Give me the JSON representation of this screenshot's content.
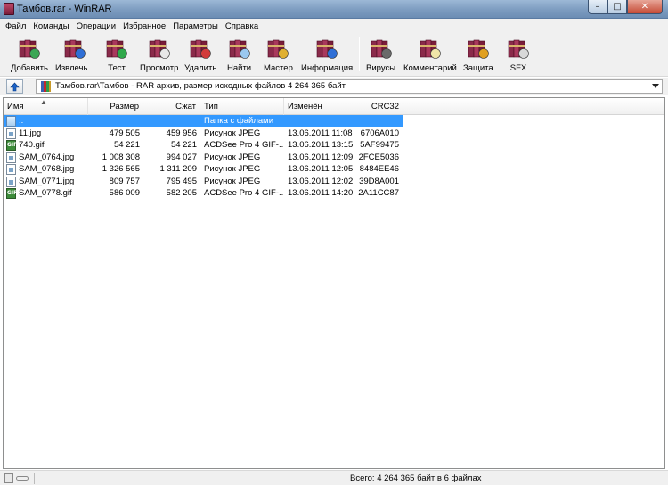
{
  "window": {
    "title": "Тамбов.rar - WinRAR",
    "min": "–",
    "max": "□",
    "close": "✕"
  },
  "menu": [
    "Файл",
    "Команды",
    "Операции",
    "Избранное",
    "Параметры",
    "Справка"
  ],
  "toolbar": {
    "buttons": [
      {
        "label": "Добавить",
        "icon": "books-add-icon"
      },
      {
        "label": "Извлечь...",
        "icon": "books-extract-icon"
      },
      {
        "label": "Тест",
        "icon": "books-test-icon"
      },
      {
        "label": "Просмотр",
        "icon": "books-view-icon"
      },
      {
        "label": "Удалить",
        "icon": "books-delete-icon"
      },
      {
        "label": "Найти",
        "icon": "books-find-icon"
      },
      {
        "label": "Мастер",
        "icon": "books-wizard-icon"
      },
      {
        "label": "Информация",
        "icon": "books-info-icon"
      },
      {
        "label": "Вирусы",
        "icon": "books-virus-icon"
      },
      {
        "label": "Комментарий",
        "icon": "books-comment-icon"
      },
      {
        "label": "Защита",
        "icon": "books-protect-icon"
      },
      {
        "label": "SFX",
        "icon": "books-sfx-icon"
      }
    ]
  },
  "address": {
    "text": "Тамбов.rar\\Тамбов - RAR архив, размер исходных файлов 4 264 365 байт"
  },
  "columns": {
    "name": "Имя",
    "size": "Размер",
    "packed": "Сжат",
    "type": "Тип",
    "modified": "Изменён",
    "crc": "CRC32"
  },
  "files": [
    {
      "name": "..",
      "size": "",
      "packed": "",
      "type": "Папка с файлами",
      "modified": "",
      "crc": "",
      "icon": "folder-up",
      "selected": true
    },
    {
      "name": "11.jpg",
      "size": "479 505",
      "packed": "459 956",
      "type": "Рисунок JPEG",
      "modified": "13.06.2011 11:08",
      "crc": "6706A010",
      "icon": "jpg"
    },
    {
      "name": "740.gif",
      "size": "54 221",
      "packed": "54 221",
      "type": "ACDSee Pro 4 GIF-...",
      "modified": "13.06.2011 13:15",
      "crc": "5AF99475",
      "icon": "gif"
    },
    {
      "name": "SAM_0764.jpg",
      "size": "1 008 308",
      "packed": "994 027",
      "type": "Рисунок JPEG",
      "modified": "13.06.2011 12:09",
      "crc": "2FCE5036",
      "icon": "jpg"
    },
    {
      "name": "SAM_0768.jpg",
      "size": "1 326 565",
      "packed": "1 311 209",
      "type": "Рисунок JPEG",
      "modified": "13.06.2011 12:05",
      "crc": "8484EE46",
      "icon": "jpg"
    },
    {
      "name": "SAM_0771.jpg",
      "size": "809 757",
      "packed": "795 495",
      "type": "Рисунок JPEG",
      "modified": "13.06.2011 12:02",
      "crc": "39D8A001",
      "icon": "jpg"
    },
    {
      "name": "SAM_0778.gif",
      "size": "586 009",
      "packed": "582 205",
      "type": "ACDSee Pro 4 GIF-...",
      "modified": "13.06.2011 14:20",
      "crc": "2A11CC87",
      "icon": "gif"
    }
  ],
  "status": {
    "text": "Всего: 4 264 365 байт в 6 файлах"
  }
}
